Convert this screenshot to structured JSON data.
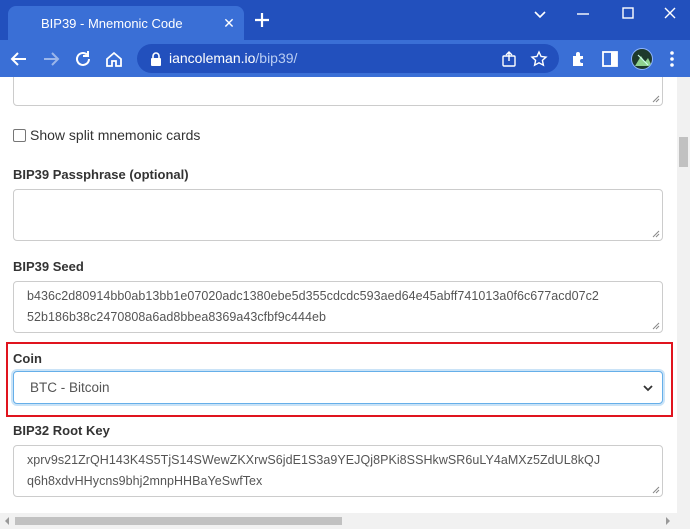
{
  "browser": {
    "tab_title": "BIP39 - Mnemonic Code",
    "url_host": "iancoleman.io",
    "url_path": "/bip39/"
  },
  "page": {
    "split_cards_label": "Show split mnemonic cards",
    "passphrase_label": "BIP39 Passphrase (optional)",
    "passphrase_value": "",
    "seed_label": "BIP39 Seed",
    "seed_line1": "b436c2d80914bb0ab13bb1e07020adc1380ebe5d355cdcdc593aed64e45abff741013a0f6c677acd07c2",
    "seed_line2": "52b186b38c2470808a6ad8bbea8369a43cfbf9c444eb",
    "coin_label": "Coin",
    "coin_selected": "BTC - Bitcoin",
    "root_key_label": "BIP32 Root Key",
    "root_key_line1": "xprv9s21ZrQH143K4S5TjS14SWewZKXrwS6jdE1S3a9YEJQj8PKi8SSHkwSR6uLY4aMXz5ZdUL8kQJ",
    "root_key_line2": "q6h8xdvHHycns9bhj2mnpHHBaYeSwfTex"
  },
  "colors": {
    "highlight": "#e0141e",
    "chrome_dark": "#2250bd",
    "chrome_light": "#3a6fd6"
  }
}
